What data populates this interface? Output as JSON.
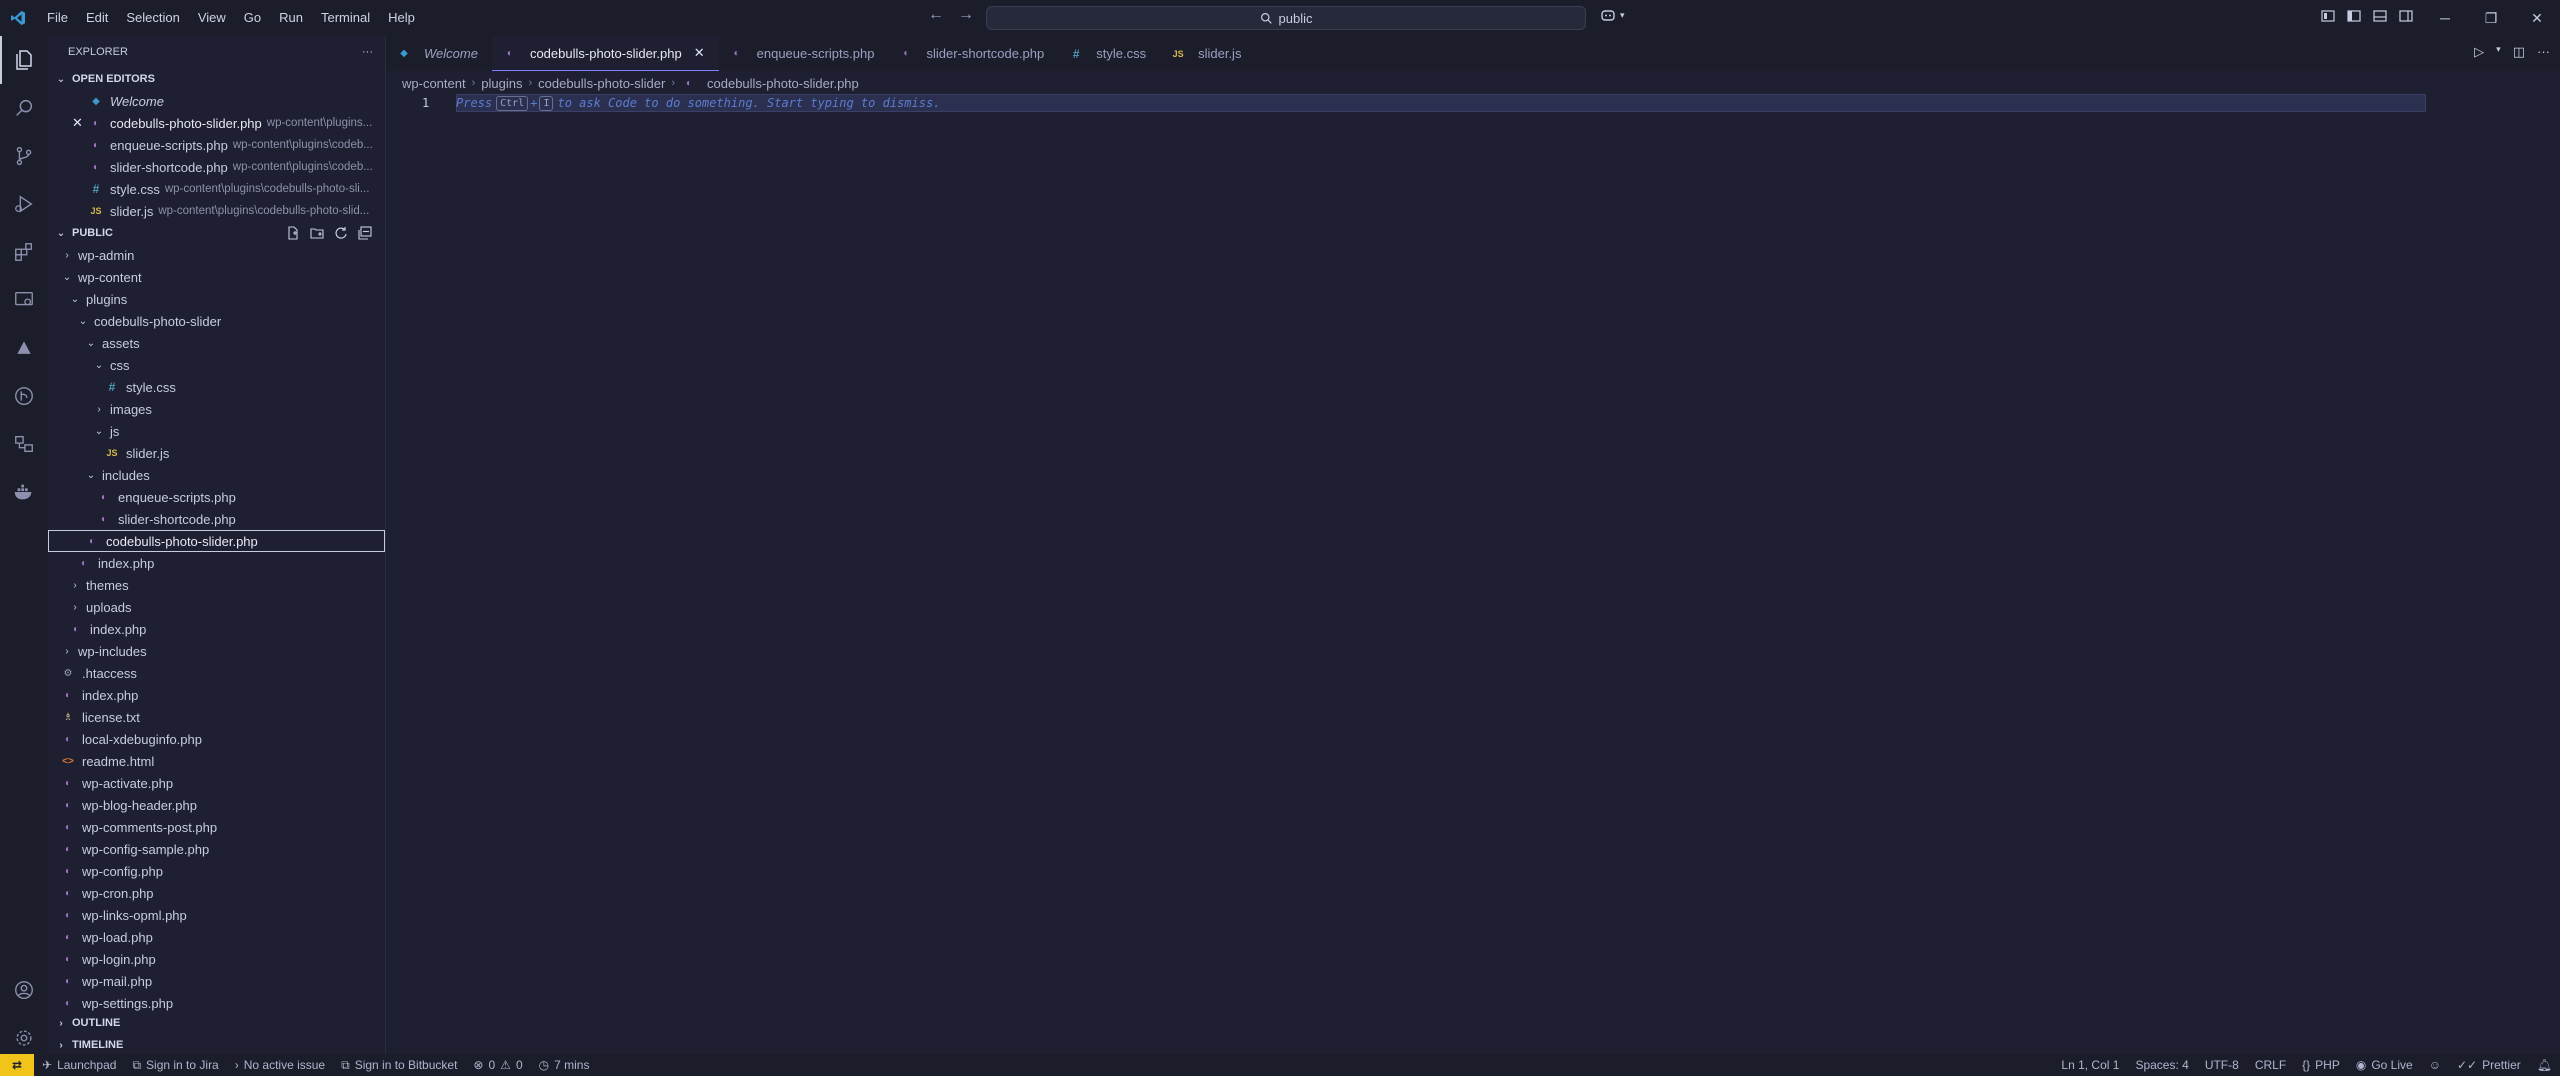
{
  "titlebar": {
    "menu": [
      "File",
      "Edit",
      "Selection",
      "View",
      "Go",
      "Run",
      "Terminal",
      "Help"
    ],
    "search": "public"
  },
  "explorer": {
    "title": "EXPLORER",
    "open_editors_label": "OPEN EDITORS",
    "open_editors": [
      {
        "name": "Welcome",
        "desc": ""
      },
      {
        "name": "codebulls-photo-slider.php",
        "desc": "wp-content\\plugins..."
      },
      {
        "name": "enqueue-scripts.php",
        "desc": "wp-content\\plugins\\codeb..."
      },
      {
        "name": "slider-shortcode.php",
        "desc": "wp-content\\plugins\\codeb..."
      },
      {
        "name": "style.css",
        "desc": "wp-content\\plugins\\codebulls-photo-sli..."
      },
      {
        "name": "slider.js",
        "desc": "wp-content\\plugins\\codebulls-photo-slid..."
      }
    ],
    "public_label": "PUBLIC",
    "tree": [
      "wp-admin",
      "wp-content",
      "plugins",
      "codebulls-photo-slider",
      "assets",
      "css",
      "style.css",
      "images",
      "js",
      "slider.js",
      "includes",
      "enqueue-scripts.php",
      "slider-shortcode.php",
      "codebulls-photo-slider.php",
      "index.php",
      "themes",
      "uploads",
      "index.php",
      "wp-includes",
      ".htaccess",
      "index.php",
      "license.txt",
      "local-xdebuginfo.php",
      "readme.html",
      "wp-activate.php",
      "wp-blog-header.php",
      "wp-comments-post.php",
      "wp-config-sample.php",
      "wp-config.php",
      "wp-cron.php",
      "wp-links-opml.php",
      "wp-load.php",
      "wp-login.php",
      "wp-mail.php",
      "wp-settings.php"
    ],
    "outline_label": "OUTLINE",
    "timeline_label": "TIMELINE"
  },
  "tabs": [
    "Welcome",
    "codebulls-photo-slider.php",
    "enqueue-scripts.php",
    "slider-shortcode.php",
    "style.css",
    "slider.js"
  ],
  "breadcrumb": [
    "wp-content",
    "plugins",
    "codebulls-photo-slider",
    "codebulls-photo-slider.php"
  ],
  "editor": {
    "line_number": "1",
    "hint_pre": "Press",
    "hint_key1": "Ctrl",
    "hint_plus": "+",
    "hint_key2": "I",
    "hint_post": "to ask Code to do something. Start typing to dismiss."
  },
  "statusbar": {
    "launchpad": "Launchpad",
    "jira": "Sign in to Jira",
    "issue": "No active issue",
    "bitbucket": "Sign in to Bitbucket",
    "errors": "0",
    "warnings": "0",
    "time": "7 mins",
    "position": "Ln 1, Col 1",
    "spaces": "Spaces: 4",
    "encoding": "UTF-8",
    "eol": "CRLF",
    "language": "PHP",
    "golive": "Go Live",
    "prettier": "Prettier"
  }
}
